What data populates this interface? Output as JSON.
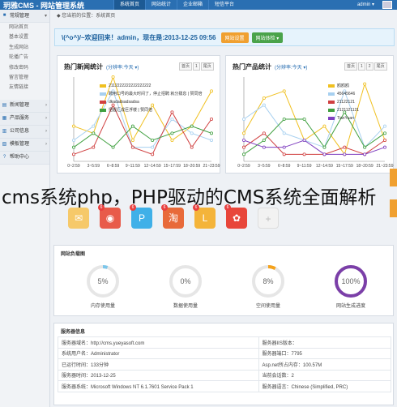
{
  "topbar": {
    "brand": "玥雅CMS - 网站管理系统",
    "nav": [
      "系统首页",
      "网站统计",
      "企业邮箱",
      "短信平台"
    ],
    "user": "admin ▾"
  },
  "sidebar": {
    "group_main": "常规管理",
    "items": [
      "网站首页",
      "基本设置",
      "生成网站",
      "轮播广告",
      "修改密码",
      "留言管理",
      "友情链接"
    ],
    "groups": [
      "新闻管理",
      "产品服务",
      "公司信息",
      "模板管理",
      "帮助中心"
    ]
  },
  "breadcrumb": "您当前的位置：系统首页",
  "welcome": {
    "text": "\\(^o^)/~欢迎回来！admin，现在是:2013-12-25 09:56",
    "btn_settings": "网站设置",
    "btn_check": "网站体检 ▾"
  },
  "news_chart": {
    "title": "热门新闻统计",
    "subtitle": "(分辨率:今天 ▾)",
    "pager": [
      "首页",
      "1",
      "尾页"
    ]
  },
  "product_chart": {
    "title": "热门产品统计",
    "subtitle": "(分辨率:今天 ▾)",
    "pager": [
      "首页",
      "1",
      "2",
      "尾页"
    ]
  },
  "chart_data": [
    {
      "type": "line",
      "x": [
        "0~2:59",
        "3~5:59",
        "6~8:59",
        "9~11:59",
        "12~14:59",
        "15~17:59",
        "18~20:59",
        "21~23:59"
      ],
      "series": [
        {
          "name": "2112222222222222222",
          "color": "#f0c020",
          "values": [
            5,
            4,
            12,
            3,
            8,
            3,
            5,
            10
          ]
        },
        {
          "name": "聘用口号的最大时间了，停止招聘 就分拨息 | 赞同倍",
          "color": "#a7d0f0",
          "values": [
            3,
            5,
            10,
            2,
            2,
            6,
            4,
            3
          ]
        },
        {
          "name": "dkadadsadsadsa",
          "color": "#d04040",
          "values": [
            1,
            2,
            8,
            2,
            1,
            7,
            2,
            6
          ]
        },
        {
          "name": "把握汇成巨浮楼 | 赞同倍",
          "color": "#40a040",
          "values": [
            2,
            4,
            2,
            5,
            3,
            4,
            5,
            4
          ]
        }
      ]
    },
    {
      "type": "line",
      "x": [
        "0~2:59",
        "3~5:59",
        "6~8:59",
        "9~11:59",
        "12~14:59",
        "15~17:59",
        "18~20:59",
        "21~23:59"
      ],
      "series": [
        {
          "name": "鸥鸥鸥",
          "color": "#f0c020",
          "values": [
            4,
            9,
            10,
            3,
            5,
            1,
            11,
            3
          ]
        },
        {
          "name": "45645646",
          "color": "#a7d0f0",
          "values": [
            6,
            8,
            4,
            3,
            2,
            10,
            2,
            5
          ]
        },
        {
          "name": "21122121",
          "color": "#d04040",
          "values": [
            2,
            4,
            1,
            1,
            1,
            2,
            1,
            3
          ]
        },
        {
          "name": "2121121121",
          "color": "#40a040",
          "values": [
            1,
            3,
            6,
            6,
            2,
            7,
            2,
            4
          ]
        },
        {
          "name": "TianYuan",
          "color": "#8040c0",
          "values": [
            3,
            2,
            2,
            3,
            1,
            1,
            1,
            2
          ]
        }
      ]
    }
  ],
  "caption": "cms系统php，PHP驱动的CMS系统全面解析",
  "icon_badges": [
    "",
    "6",
    "6",
    "6",
    "6",
    "6",
    ""
  ],
  "load": {
    "title": "网站负载图",
    "gauges": [
      {
        "value": "5%",
        "pct": 5,
        "label": "内存使用量",
        "color": "#7cc6ea"
      },
      {
        "value": "0%",
        "pct": 0,
        "label": "数据使用量",
        "color": "#7cc6ea"
      },
      {
        "value": "8%",
        "pct": 8,
        "label": "空间使用量",
        "color": "#f5a21b"
      },
      {
        "value": "100%",
        "pct": 100,
        "label": "网站生成进度",
        "color": "#7b3fa8"
      }
    ]
  },
  "server": {
    "title": "服务器信息",
    "rows": [
      [
        "服务器域名：http://cms.yueyasoft.com",
        "服务器IIS版本："
      ],
      [
        "系统用户名：Administrator",
        "服务器端口：7795"
      ],
      [
        "已运行时间：133分钟",
        "Asp.net所占内存：100.57M"
      ],
      [
        "服务器时间：2013-12-25",
        "当前会话数：2"
      ],
      [
        "服务器系统：Microsoft Windows NT 6.1.7601 Service Pack 1",
        "服务器语言：Chinese (Simplified, PRC)"
      ]
    ]
  }
}
